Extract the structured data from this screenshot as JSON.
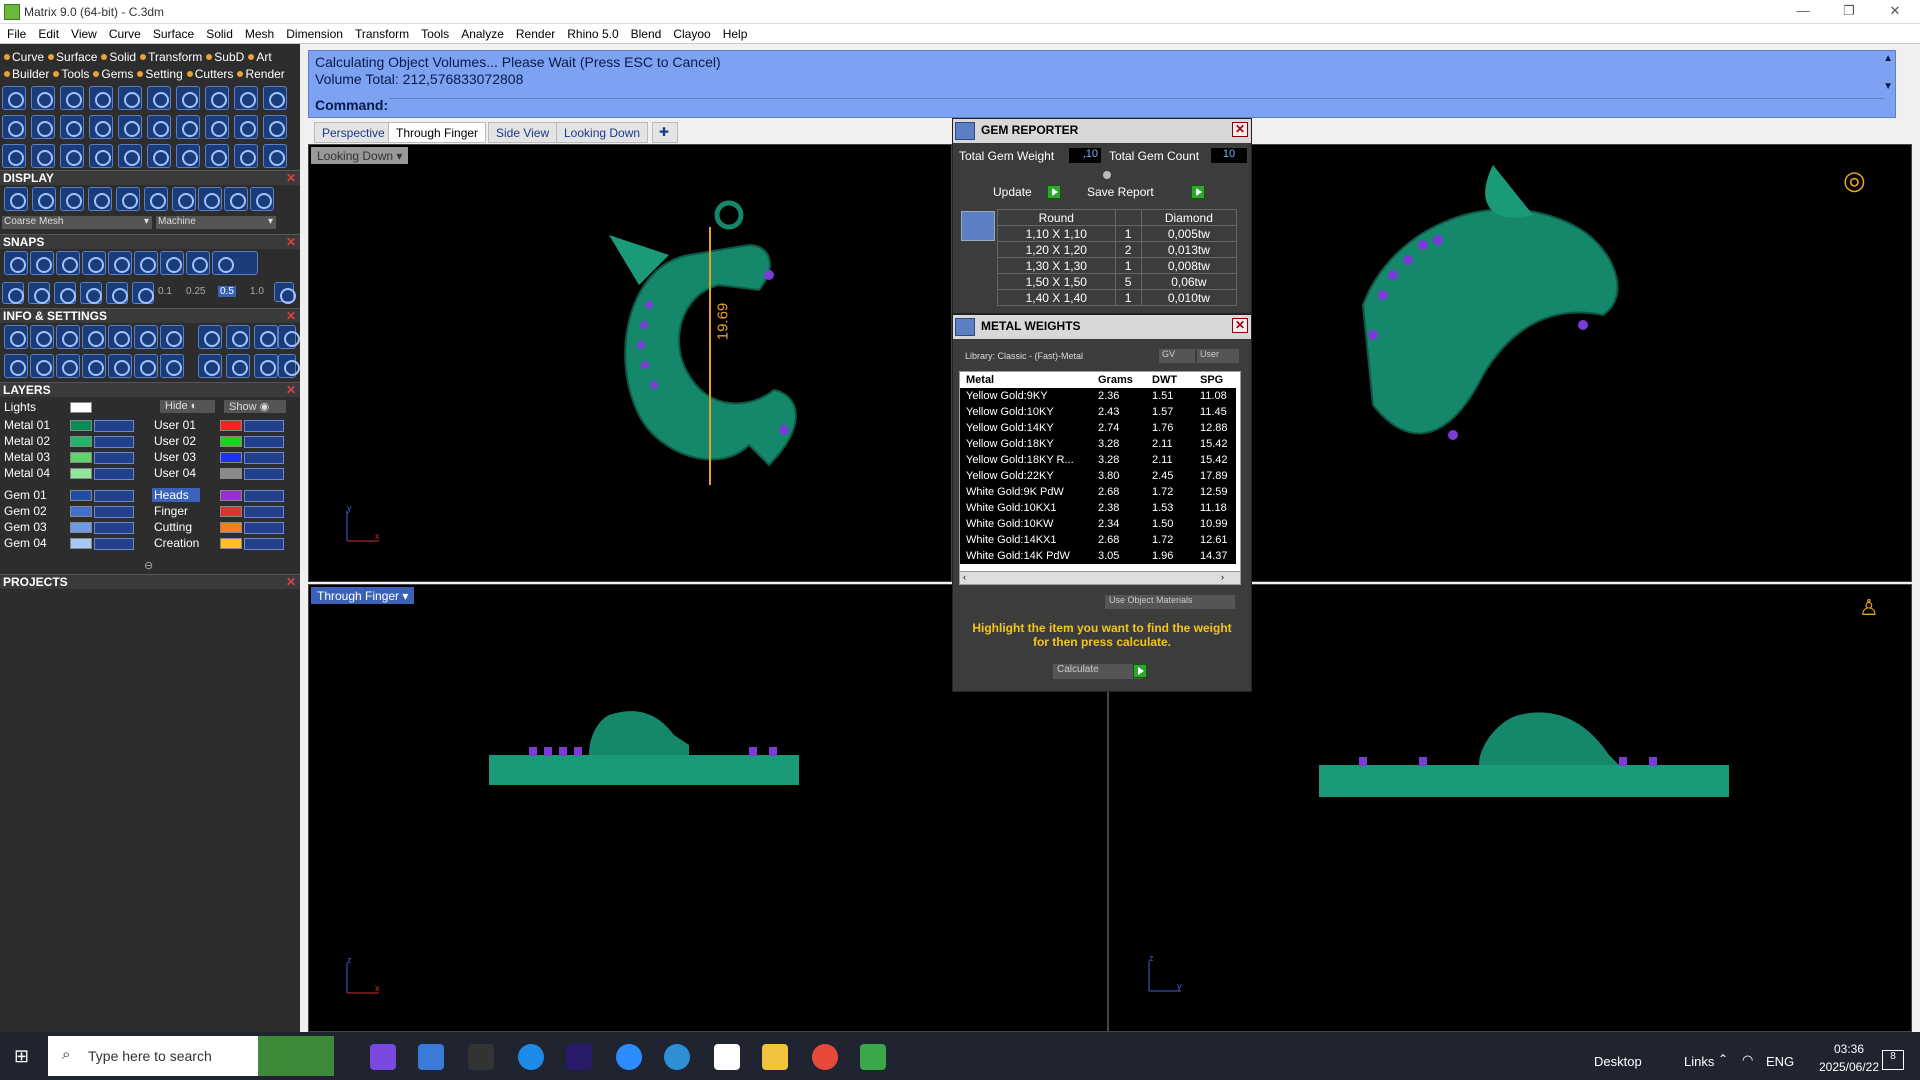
{
  "window": {
    "title": "Matrix 9.0 (64-bit) - C.3dm"
  },
  "menu": [
    "File",
    "Edit",
    "View",
    "Curve",
    "Surface",
    "Solid",
    "Mesh",
    "Dimension",
    "Transform",
    "Tools",
    "Analyze",
    "Render",
    "Rhino 5.0",
    "Blend",
    "Clayoo",
    "Help"
  ],
  "left_tabs_row1": [
    "Curve",
    "Surface",
    "Solid",
    "Transform",
    "SubD",
    "Art"
  ],
  "left_tabs_row2": [
    "Builder",
    "Tools",
    "Gems",
    "Setting",
    "Cutters",
    "Render"
  ],
  "display": {
    "header": "DISPLAY",
    "mesh_select": "Coarse Mesh",
    "material_select": "Machine"
  },
  "snaps": {
    "header": "SNAPS",
    "values": [
      "0.1",
      "0.25",
      "0.5",
      "1.0"
    ]
  },
  "info_settings": {
    "header": "INFO & SETTINGS"
  },
  "layers": {
    "header": "LAYERS",
    "lights_label": "Lights",
    "hide_label": "Hide",
    "show_label": "Show",
    "left": [
      {
        "name": "Metal 01",
        "color": "#0c8a55"
      },
      {
        "name": "Metal 02",
        "color": "#22b46a"
      },
      {
        "name": "Metal 03",
        "color": "#5ed46b"
      },
      {
        "name": "Metal 04",
        "color": "#8fe89a"
      },
      {
        "name": "Gem 01",
        "color": "#1e4fa8"
      },
      {
        "name": "Gem 02",
        "color": "#3f6fcf"
      },
      {
        "name": "Gem 03",
        "color": "#6f9ae6"
      },
      {
        "name": "Gem 04",
        "color": "#a9c8f5"
      }
    ],
    "right": [
      {
        "name": "User 01",
        "color": "#ff2020"
      },
      {
        "name": "User 02",
        "color": "#20d020"
      },
      {
        "name": "User 03",
        "color": "#2030ff"
      },
      {
        "name": "User 04",
        "color": "#8a8a8a"
      },
      {
        "name": "Heads",
        "color": "#9a2fd0"
      },
      {
        "name": "Finger",
        "color": "#e03030"
      },
      {
        "name": "Cutting",
        "color": "#ff7a1a"
      },
      {
        "name": "Creation",
        "color": "#ffc020"
      }
    ]
  },
  "projects": {
    "header": "PROJECTS"
  },
  "command": {
    "line1": "Calculating Object Volumes... Please Wait (Press ESC to Cancel)",
    "line2": "Volume Total: 212,576833072808",
    "prompt": "Command:"
  },
  "view_tabs": [
    "Perspective",
    "Through Finger",
    "Side View",
    "Looking Down"
  ],
  "active_tab": "Through Finger",
  "viewports": {
    "top_left": {
      "label": "Looking Down",
      "dimension": "19.69"
    },
    "bottom_left": {
      "label": "Through Finger"
    }
  },
  "gem_reporter": {
    "title": "GEM REPORTER",
    "weight_label": "Total Gem Weight",
    "weight_value": ",10",
    "count_label": "Total Gem Count",
    "count_value": "10",
    "update_label": "Update",
    "save_label": "Save Report",
    "col_shape": "Round",
    "col_type": "Diamond",
    "rows": [
      {
        "size": "1,10 X 1,10",
        "qty": "1",
        "wt": "0,005tw"
      },
      {
        "size": "1,20 X 1,20",
        "qty": "2",
        "wt": "0,013tw"
      },
      {
        "size": "1,30 X 1,30",
        "qty": "1",
        "wt": "0,008tw"
      },
      {
        "size": "1,50 X 1,50",
        "qty": "5",
        "wt": "0,06tw"
      },
      {
        "size": "1,40 X 1,40",
        "qty": "1",
        "wt": "0,010tw"
      }
    ]
  },
  "metal_weights": {
    "title": "METAL WEIGHTS",
    "library": "Library: Classic - (Fast)-Metal",
    "gv_label": "GV",
    "user_label": "User",
    "headers": [
      "Metal",
      "Grams",
      "DWT",
      "SPG"
    ],
    "rows": [
      [
        "Yellow Gold:9KY",
        "2.36",
        "1.51",
        "11.08"
      ],
      [
        "Yellow Gold:10KY",
        "2.43",
        "1.57",
        "11.45"
      ],
      [
        "Yellow Gold:14KY",
        "2.74",
        "1.76",
        "12.88"
      ],
      [
        "Yellow Gold:18KY",
        "3.28",
        "2.11",
        "15.42"
      ],
      [
        "Yellow Gold:18KY R...",
        "3.28",
        "2.11",
        "15.42"
      ],
      [
        "Yellow Gold:22KY",
        "3.80",
        "2.45",
        "17.89"
      ],
      [
        "White Gold:9K PdW",
        "2.68",
        "1.72",
        "12.59"
      ],
      [
        "White Gold:10KX1",
        "2.38",
        "1.53",
        "11.18"
      ],
      [
        "White Gold:10KW",
        "2.34",
        "1.50",
        "10.99"
      ],
      [
        "White Gold:14KX1",
        "2.68",
        "1.72",
        "12.61"
      ],
      [
        "White Gold:14K PdW",
        "3.05",
        "1.96",
        "14.37"
      ]
    ],
    "use_object_label": "Use Object Materials",
    "hint": "Highlight the item you want to find the weight for then press calculate.",
    "calculate_label": "Calculate"
  },
  "taskbar": {
    "search_placeholder": "Type here to search",
    "desktop": "Desktop",
    "links": "Links",
    "lang": "ENG",
    "time": "03:36",
    "date": "2025/06/22",
    "notif_count": "8"
  }
}
